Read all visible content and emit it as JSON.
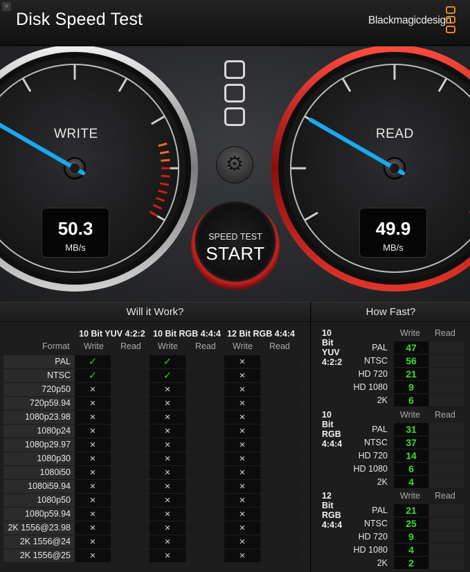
{
  "window": {
    "title": "Disk Speed Test",
    "brand": "Blackmagicdesign",
    "close_glyph": "×"
  },
  "gauges": {
    "write": {
      "label": "WRITE",
      "value": "50.3",
      "unit": "MB/s",
      "needle_fraction": 0.25
    },
    "read": {
      "label": "READ",
      "value": "49.9",
      "unit": "MB/s",
      "needle_fraction": 0.25
    }
  },
  "controls": {
    "settings_icon": "gear-icon",
    "start_line1": "SPEED TEST",
    "start_line2": "START"
  },
  "will_it_work": {
    "title": "Will it Work?",
    "format_header": "Format",
    "groups": [
      "10 Bit YUV 4:2:2",
      "10 Bit RGB 4:4:4",
      "12 Bit RGB 4:4:4"
    ],
    "write_label": "Write",
    "read_label": "Read",
    "rows": [
      {
        "format": "PAL",
        "w": [
          "✓",
          "✓",
          "✕"
        ]
      },
      {
        "format": "NTSC",
        "w": [
          "✓",
          "✓",
          "✕"
        ]
      },
      {
        "format": "720p50",
        "w": [
          "✕",
          "✕",
          "✕"
        ]
      },
      {
        "format": "720p59.94",
        "w": [
          "✕",
          "✕",
          "✕"
        ]
      },
      {
        "format": "1080p23.98",
        "w": [
          "✕",
          "✕",
          "✕"
        ]
      },
      {
        "format": "1080p24",
        "w": [
          "✕",
          "✕",
          "✕"
        ]
      },
      {
        "format": "1080p29.97",
        "w": [
          "✕",
          "✕",
          "✕"
        ]
      },
      {
        "format": "1080p30",
        "w": [
          "✕",
          "✕",
          "✕"
        ]
      },
      {
        "format": "1080i50",
        "w": [
          "✕",
          "✕",
          "✕"
        ]
      },
      {
        "format": "1080i59.94",
        "w": [
          "✕",
          "✕",
          "✕"
        ]
      },
      {
        "format": "1080p50",
        "w": [
          "✕",
          "✕",
          "✕"
        ]
      },
      {
        "format": "1080p59.94",
        "w": [
          "✕",
          "✕",
          "✕"
        ]
      },
      {
        "format": "2K 1556@23.98",
        "w": [
          "✕",
          "✕",
          "✕"
        ]
      },
      {
        "format": "2K 1556@24",
        "w": [
          "✕",
          "✕",
          "✕"
        ]
      },
      {
        "format": "2K 1556@25",
        "w": [
          "✕",
          "✕",
          "✕"
        ]
      }
    ]
  },
  "how_fast": {
    "title": "How Fast?",
    "write_label": "Write",
    "read_label": "Read",
    "sections": [
      {
        "group": "10 Bit YUV 4:2:2",
        "rows": [
          {
            "name": "PAL",
            "write": "47"
          },
          {
            "name": "NTSC",
            "write": "56"
          },
          {
            "name": "HD 720",
            "write": "21"
          },
          {
            "name": "HD 1080",
            "write": "9"
          },
          {
            "name": "2K",
            "write": "6"
          }
        ]
      },
      {
        "group": "10 Bit RGB 4:4:4",
        "rows": [
          {
            "name": "PAL",
            "write": "31"
          },
          {
            "name": "NTSC",
            "write": "37"
          },
          {
            "name": "HD 720",
            "write": "14"
          },
          {
            "name": "HD 1080",
            "write": "6"
          },
          {
            "name": "2K",
            "write": "4"
          }
        ]
      },
      {
        "group": "12 Bit RGB 4:4:4",
        "rows": [
          {
            "name": "PAL",
            "write": "21"
          },
          {
            "name": "NTSC",
            "write": "25"
          },
          {
            "name": "HD 720",
            "write": "9"
          },
          {
            "name": "HD 1080",
            "write": "4"
          },
          {
            "name": "2K",
            "write": "2"
          }
        ]
      }
    ]
  },
  "colors": {
    "accent_orange": "#e38a27",
    "needle_blue": "#1aa9f0",
    "ok_green": "#34c324",
    "value_green": "#3bdd2a",
    "read_ring_red": "#b8191a"
  }
}
